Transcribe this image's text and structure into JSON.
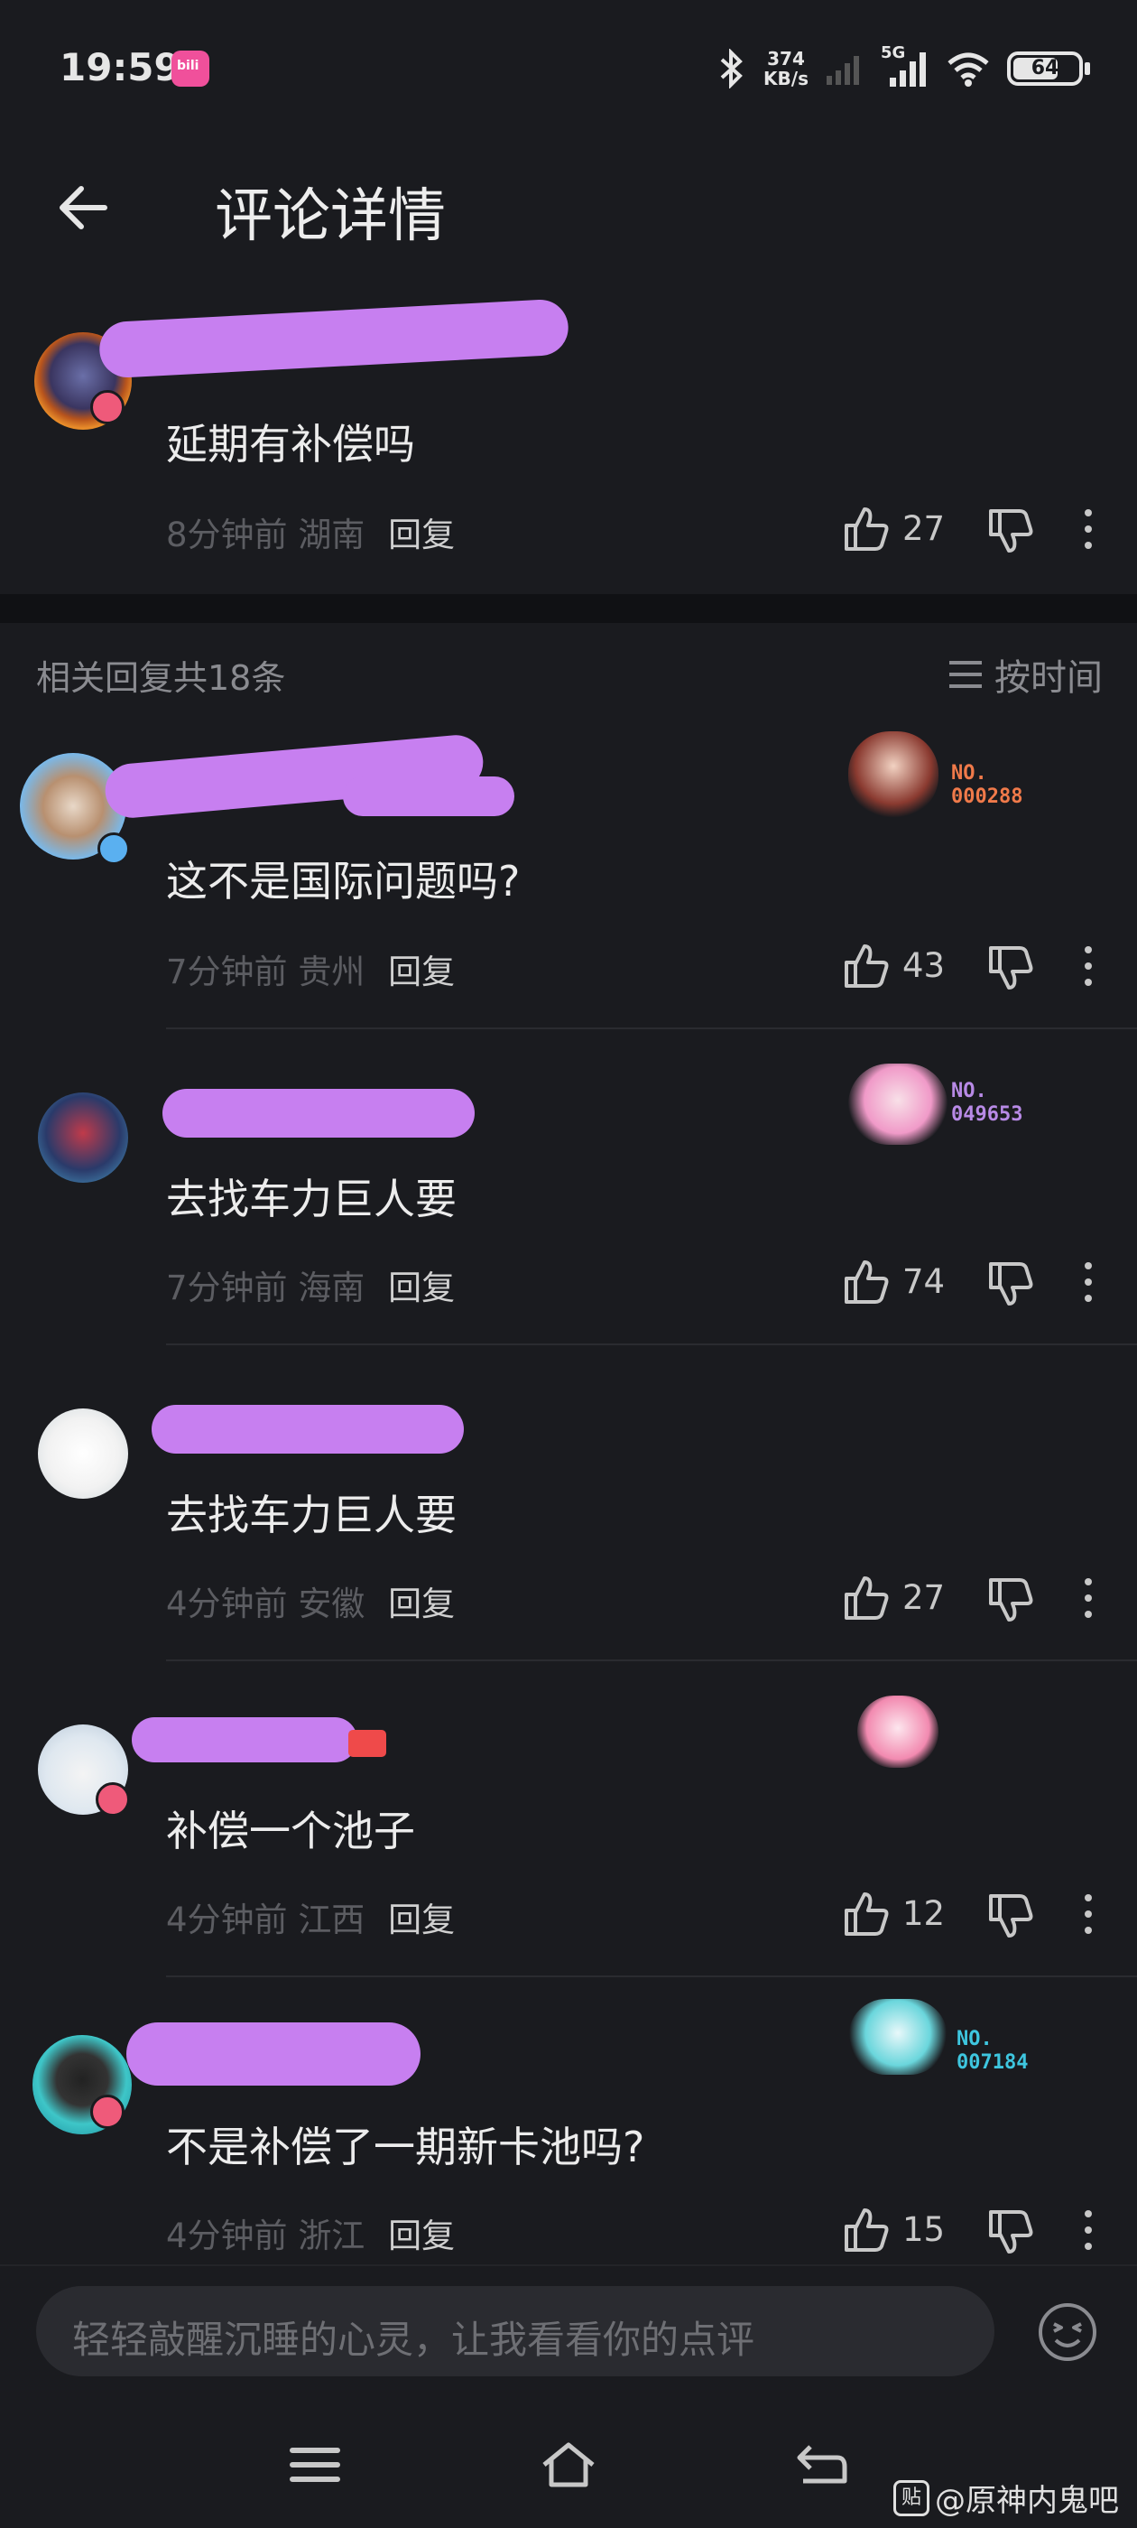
{
  "status": {
    "time": "19:59",
    "app_badge": "bili",
    "speed_value": "374",
    "speed_unit": "KB/s",
    "network": "5G",
    "battery": "64"
  },
  "header": {
    "title": "评论详情",
    "back_icon": "arrow-left-icon"
  },
  "main_comment": {
    "text": "延期有补偿吗",
    "time": "8分钟前",
    "location": "湖南",
    "reply": "回复",
    "likes": "27"
  },
  "replies_header": {
    "count_text": "相关回复共18条",
    "sort_label": "按时间"
  },
  "replies": [
    {
      "text": "这不是国际问题吗?",
      "time": "7分钟前",
      "location": "贵州",
      "reply": "回复",
      "likes": "43",
      "badge_no": "NO.",
      "badge_id": "000288",
      "badge_color": "#f07a4a"
    },
    {
      "text": "去找车力巨人要",
      "time": "7分钟前",
      "location": "海南",
      "reply": "回复",
      "likes": "74",
      "badge_no": "NO.",
      "badge_id": "049653",
      "badge_color": "#b88ae6"
    },
    {
      "text": "去找车力巨人要",
      "time": "4分钟前",
      "location": "安徽",
      "reply": "回复",
      "likes": "27"
    },
    {
      "text": "补偿一个池子",
      "time": "4分钟前",
      "location": "江西",
      "reply": "回复",
      "likes": "12"
    },
    {
      "text": "不是补偿了一期新卡池吗?",
      "time": "4分钟前",
      "location": "浙江",
      "reply": "回复",
      "likes": "15",
      "badge_no": "NO.",
      "badge_id": "007184",
      "badge_color": "#3ec6df"
    }
  ],
  "input": {
    "placeholder": "轻轻敲醒沉睡的心灵，让我看看你的点评"
  },
  "watermark": {
    "logo": "贴",
    "text": "@原神内鬼吧"
  },
  "colors": {
    "background": "#1a1b1f",
    "mask": "#c77ff0",
    "meta": "#5c5d62"
  }
}
